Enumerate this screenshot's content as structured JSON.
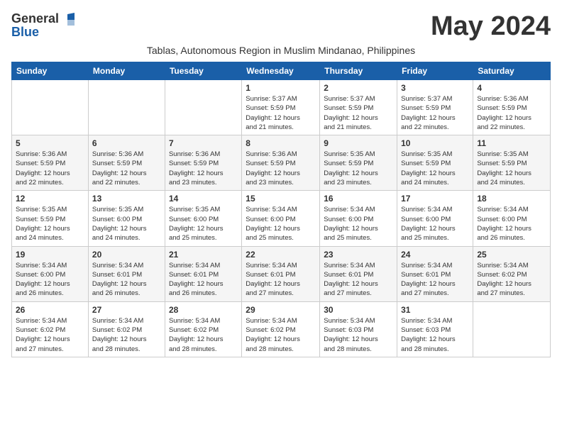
{
  "header": {
    "logo_general": "General",
    "logo_blue": "Blue",
    "month_title": "May 2024",
    "subtitle": "Tablas, Autonomous Region in Muslim Mindanao, Philippines"
  },
  "weekdays": [
    "Sunday",
    "Monday",
    "Tuesday",
    "Wednesday",
    "Thursday",
    "Friday",
    "Saturday"
  ],
  "weeks": [
    [
      {
        "day": "",
        "info": ""
      },
      {
        "day": "",
        "info": ""
      },
      {
        "day": "",
        "info": ""
      },
      {
        "day": "1",
        "info": "Sunrise: 5:37 AM\nSunset: 5:59 PM\nDaylight: 12 hours\nand 21 minutes."
      },
      {
        "day": "2",
        "info": "Sunrise: 5:37 AM\nSunset: 5:59 PM\nDaylight: 12 hours\nand 21 minutes."
      },
      {
        "day": "3",
        "info": "Sunrise: 5:37 AM\nSunset: 5:59 PM\nDaylight: 12 hours\nand 22 minutes."
      },
      {
        "day": "4",
        "info": "Sunrise: 5:36 AM\nSunset: 5:59 PM\nDaylight: 12 hours\nand 22 minutes."
      }
    ],
    [
      {
        "day": "5",
        "info": "Sunrise: 5:36 AM\nSunset: 5:59 PM\nDaylight: 12 hours\nand 22 minutes."
      },
      {
        "day": "6",
        "info": "Sunrise: 5:36 AM\nSunset: 5:59 PM\nDaylight: 12 hours\nand 22 minutes."
      },
      {
        "day": "7",
        "info": "Sunrise: 5:36 AM\nSunset: 5:59 PM\nDaylight: 12 hours\nand 23 minutes."
      },
      {
        "day": "8",
        "info": "Sunrise: 5:36 AM\nSunset: 5:59 PM\nDaylight: 12 hours\nand 23 minutes."
      },
      {
        "day": "9",
        "info": "Sunrise: 5:35 AM\nSunset: 5:59 PM\nDaylight: 12 hours\nand 23 minutes."
      },
      {
        "day": "10",
        "info": "Sunrise: 5:35 AM\nSunset: 5:59 PM\nDaylight: 12 hours\nand 24 minutes."
      },
      {
        "day": "11",
        "info": "Sunrise: 5:35 AM\nSunset: 5:59 PM\nDaylight: 12 hours\nand 24 minutes."
      }
    ],
    [
      {
        "day": "12",
        "info": "Sunrise: 5:35 AM\nSunset: 5:59 PM\nDaylight: 12 hours\nand 24 minutes."
      },
      {
        "day": "13",
        "info": "Sunrise: 5:35 AM\nSunset: 6:00 PM\nDaylight: 12 hours\nand 24 minutes."
      },
      {
        "day": "14",
        "info": "Sunrise: 5:35 AM\nSunset: 6:00 PM\nDaylight: 12 hours\nand 25 minutes."
      },
      {
        "day": "15",
        "info": "Sunrise: 5:34 AM\nSunset: 6:00 PM\nDaylight: 12 hours\nand 25 minutes."
      },
      {
        "day": "16",
        "info": "Sunrise: 5:34 AM\nSunset: 6:00 PM\nDaylight: 12 hours\nand 25 minutes."
      },
      {
        "day": "17",
        "info": "Sunrise: 5:34 AM\nSunset: 6:00 PM\nDaylight: 12 hours\nand 25 minutes."
      },
      {
        "day": "18",
        "info": "Sunrise: 5:34 AM\nSunset: 6:00 PM\nDaylight: 12 hours\nand 26 minutes."
      }
    ],
    [
      {
        "day": "19",
        "info": "Sunrise: 5:34 AM\nSunset: 6:00 PM\nDaylight: 12 hours\nand 26 minutes."
      },
      {
        "day": "20",
        "info": "Sunrise: 5:34 AM\nSunset: 6:01 PM\nDaylight: 12 hours\nand 26 minutes."
      },
      {
        "day": "21",
        "info": "Sunrise: 5:34 AM\nSunset: 6:01 PM\nDaylight: 12 hours\nand 26 minutes."
      },
      {
        "day": "22",
        "info": "Sunrise: 5:34 AM\nSunset: 6:01 PM\nDaylight: 12 hours\nand 27 minutes."
      },
      {
        "day": "23",
        "info": "Sunrise: 5:34 AM\nSunset: 6:01 PM\nDaylight: 12 hours\nand 27 minutes."
      },
      {
        "day": "24",
        "info": "Sunrise: 5:34 AM\nSunset: 6:01 PM\nDaylight: 12 hours\nand 27 minutes."
      },
      {
        "day": "25",
        "info": "Sunrise: 5:34 AM\nSunset: 6:02 PM\nDaylight: 12 hours\nand 27 minutes."
      }
    ],
    [
      {
        "day": "26",
        "info": "Sunrise: 5:34 AM\nSunset: 6:02 PM\nDaylight: 12 hours\nand 27 minutes."
      },
      {
        "day": "27",
        "info": "Sunrise: 5:34 AM\nSunset: 6:02 PM\nDaylight: 12 hours\nand 28 minutes."
      },
      {
        "day": "28",
        "info": "Sunrise: 5:34 AM\nSunset: 6:02 PM\nDaylight: 12 hours\nand 28 minutes."
      },
      {
        "day": "29",
        "info": "Sunrise: 5:34 AM\nSunset: 6:02 PM\nDaylight: 12 hours\nand 28 minutes."
      },
      {
        "day": "30",
        "info": "Sunrise: 5:34 AM\nSunset: 6:03 PM\nDaylight: 12 hours\nand 28 minutes."
      },
      {
        "day": "31",
        "info": "Sunrise: 5:34 AM\nSunset: 6:03 PM\nDaylight: 12 hours\nand 28 minutes."
      },
      {
        "day": "",
        "info": ""
      }
    ]
  ]
}
